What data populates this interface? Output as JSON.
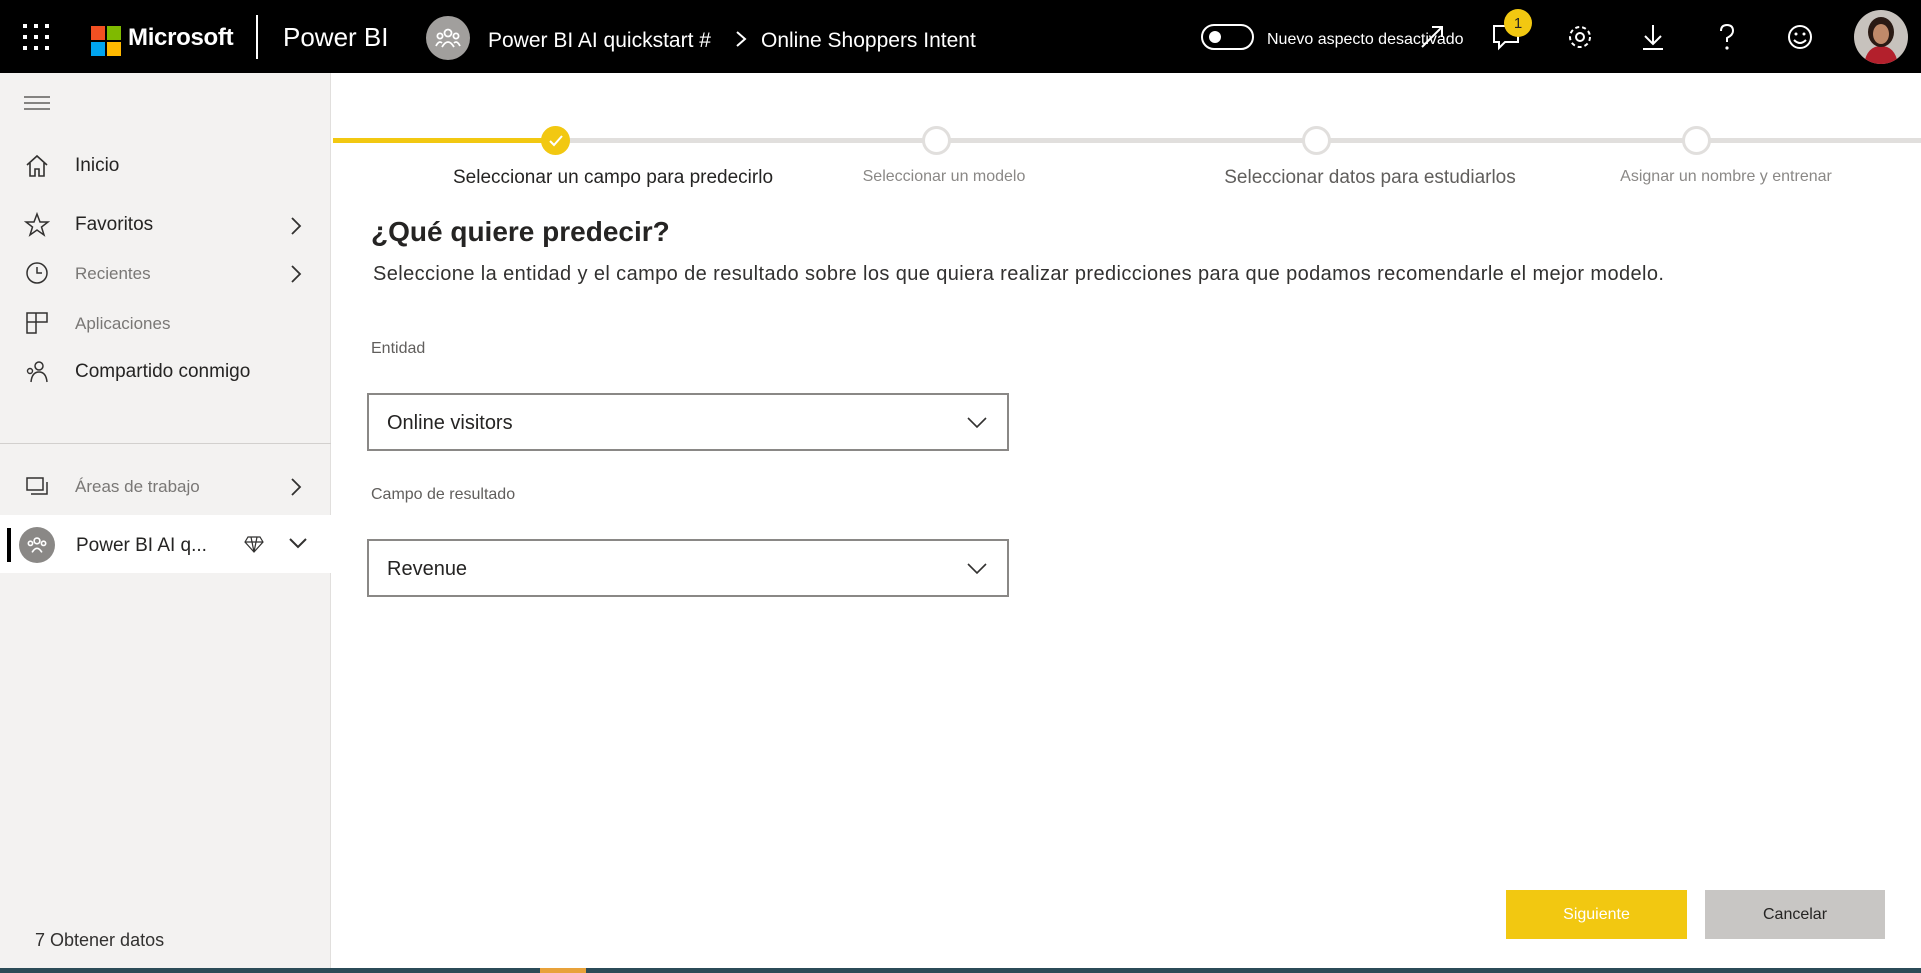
{
  "topbar": {
    "brand": "Microsoft",
    "app_name": "Power BI",
    "workspace_name": "Power BI AI quickstart #",
    "breadcrumb_item": "Online Shoppers Intent",
    "toggle_label": "Nuevo aspecto desactivado",
    "toggle_on": false,
    "notification_count": "1",
    "icons": [
      "waffle-icon",
      "expand-icon",
      "notifications-icon",
      "settings-icon",
      "download-icon",
      "help-icon",
      "feedback-icon"
    ]
  },
  "sidebar": {
    "items": [
      {
        "label": "Inicio",
        "icon": "home-icon"
      },
      {
        "label": "Favoritos",
        "icon": "star-icon"
      },
      {
        "label": "Recientes",
        "icon": "clock-icon"
      },
      {
        "label": "Aplicaciones",
        "icon": "apps-icon"
      },
      {
        "label": "Compartido conmigo",
        "icon": "shared-icon"
      },
      {
        "label": "Áreas de trabajo",
        "icon": "workspaces-icon"
      }
    ],
    "current_workspace": "Power BI AI q...",
    "get_data": "7 Obtener datos"
  },
  "stepper": {
    "steps": [
      {
        "label": "Seleccionar un campo para predecirlo",
        "state": "done"
      },
      {
        "label": "Seleccionar un modelo",
        "state": "pending"
      },
      {
        "label": "Seleccionar datos para estudiarlos",
        "state": "pending"
      },
      {
        "label": "Asignar un nombre y entrenar",
        "state": "pending"
      }
    ]
  },
  "form": {
    "heading": "¿Qué quiere predecir?",
    "description": "Seleccione la entidad y el campo de resultado sobre los que quiera realizar predicciones para que podamos recomendarle el mejor modelo.",
    "entity_label": "Entidad",
    "entity_value": "Online visitors",
    "outcome_label": "Campo de resultado",
    "outcome_value": "Revenue"
  },
  "buttons": {
    "next": "Siguiente",
    "cancel": "Cancelar"
  },
  "colors": {
    "accent": "#f2c811",
    "topbar": "#000000",
    "sidebar": "#f3f2f1",
    "cancel": "#c8c6c4"
  }
}
